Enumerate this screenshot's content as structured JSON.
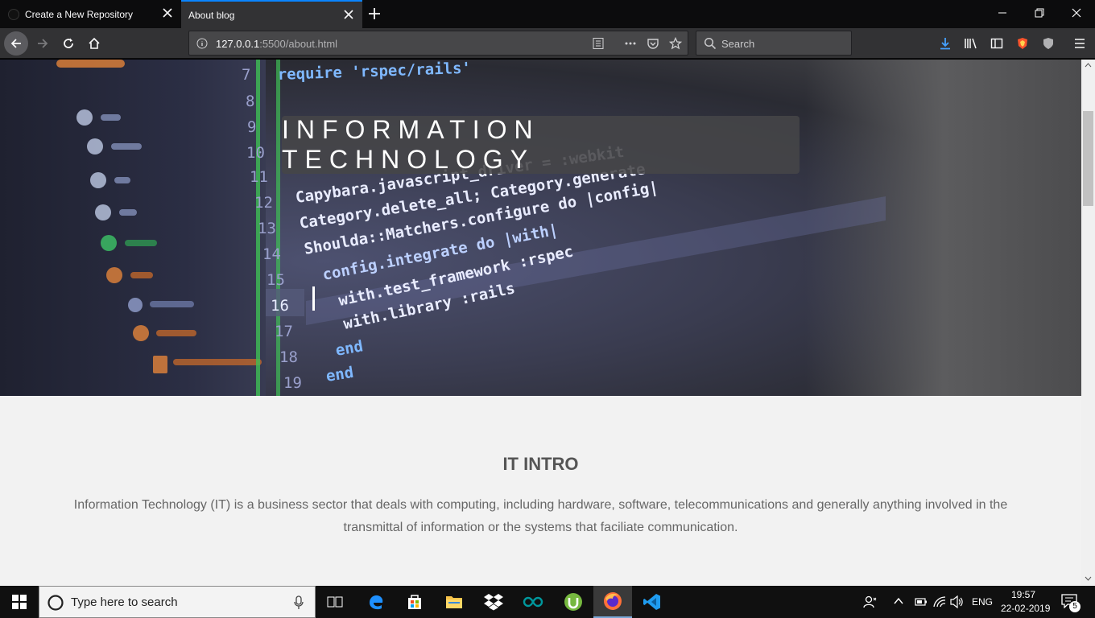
{
  "browser": {
    "tabs": [
      {
        "title": "Create a New Repository",
        "active": false
      },
      {
        "title": "About blog",
        "active": true
      }
    ],
    "url_host": "127.0.0.1",
    "url_rest": ":5500/about.html",
    "search_placeholder": "Search"
  },
  "page": {
    "hero_title": "INFORMATION TECHNOLOGY",
    "intro_title": "IT INTRO",
    "intro_text": "Information Technology (IT) is a business sector that deals with computing, including hardware, software, telecommunications and generally anything involved in the transmittal of information or the systems that faciliate communication.",
    "code_lines": [
      {
        "num": "7",
        "text": "require 'rspec/rails'"
      },
      {
        "num": "8",
        "text": ""
      },
      {
        "num": "9",
        "text": ""
      },
      {
        "num": "10",
        "text": ""
      },
      {
        "num": "11",
        "text": ""
      },
      {
        "num": "12",
        "text": "Capybara.javascript_driver = :webkit"
      },
      {
        "num": "13",
        "text": "Category.delete_all; Category.generate"
      },
      {
        "num": "14",
        "text": "Shoulda::Matchers.configure do |config|"
      },
      {
        "num": "15",
        "text": "config.integrate do |with|"
      },
      {
        "num": "16",
        "text": "with.test_framework :rspec"
      },
      {
        "num": "17",
        "text": "with.library :rails"
      },
      {
        "num": "18",
        "text": "end"
      },
      {
        "num": "19",
        "text": "end"
      }
    ]
  },
  "taskbar": {
    "search_placeholder": "Type here to search",
    "language": "ENG",
    "time": "19:57",
    "date": "22-02-2019",
    "notification_count": "5"
  },
  "colors": {
    "accent": "#0a84ff",
    "tab_bar": "#0c0c0d",
    "toolbar": "#323234",
    "page_bg": "#f2f2f2"
  }
}
